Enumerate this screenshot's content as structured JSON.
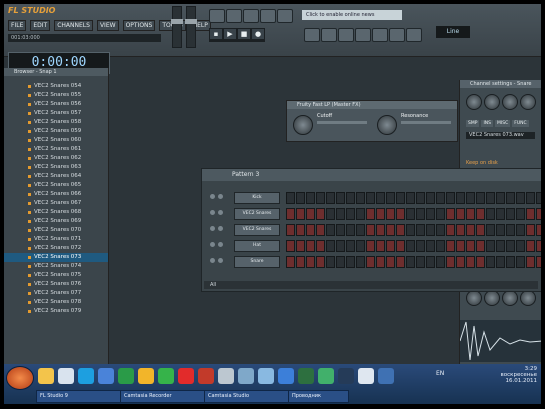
{
  "app": {
    "logo": "FL STUDIO",
    "menus": [
      "FILE",
      "EDIT",
      "CHANNELS",
      "VIEW",
      "OPTIONS",
      "TOOLS",
      "HELP"
    ],
    "hint": "001:03:000",
    "time": "0:00:00",
    "hint_bar": "Click to enable online news",
    "tempo": "Line"
  },
  "browser": {
    "title": "Browser - Snap 1",
    "items": [
      "VEC2 Snares 054",
      "VEC2 Snares 055",
      "VEC2 Snares 056",
      "VEC2 Snares 057",
      "VEC2 Snares 058",
      "VEC2 Snares 059",
      "VEC2 Snares 060",
      "VEC2 Snares 061",
      "VEC2 Snares 062",
      "VEC2 Snares 063",
      "VEC2 Snares 064",
      "VEC2 Snares 065",
      "VEC2 Snares 066",
      "VEC2 Snares 067",
      "VEC2 Snares 068",
      "VEC2 Snares 069",
      "VEC2 Snares 070",
      "VEC2 Snares 071",
      "VEC2 Snares 072",
      "VEC2 Snares 073",
      "VEC2 Snares 074",
      "VEC2 Snares 075",
      "VEC2 Snares 076",
      "VEC2 Snares 077",
      "VEC2 Snares 078",
      "VEC2 Snares 079"
    ],
    "selected_index": 19
  },
  "filter": {
    "title": "Fruity Fast LP (Master FX)",
    "cutoff_label": "Cutoff",
    "resonance_label": "Resonance"
  },
  "channel_settings": {
    "title": "Channel settings - Snare",
    "tabs": [
      "SMP",
      "INS",
      "MISC",
      "FUNC"
    ],
    "channel_name": "VEC2 Snares 073.wav",
    "option_label": "Keep on disk"
  },
  "pattern": {
    "title": "Pattern 3",
    "channels": [
      {
        "label": "Kick"
      },
      {
        "label": "VEC2 Snares"
      },
      {
        "label": "VEC2 Snares"
      },
      {
        "label": "Hat"
      },
      {
        "label": "Snare"
      }
    ],
    "footer": "All"
  },
  "taskbar": {
    "items": [
      "FL Studio 9",
      "Camtasia Recorder",
      "Camtasia Studio",
      "Проводник"
    ],
    "lang": "EN",
    "time": "3:29",
    "day": "воскресенье",
    "date": "16.01.2011"
  },
  "colors": {
    "accent": "#e49a2e",
    "selection": "#1f5a80",
    "step_active": "#6e2e2e",
    "taskbar": "#173252"
  }
}
